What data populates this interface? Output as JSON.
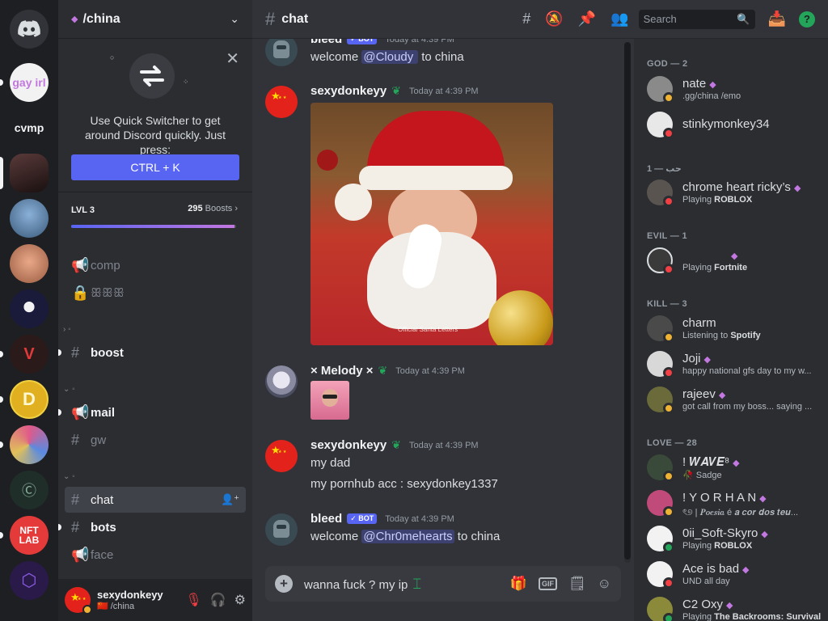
{
  "topbar": {
    "channel": "chat",
    "search_placeholder": "Search"
  },
  "guild": {
    "name": "/china"
  },
  "quick_switcher": {
    "text": "Use Quick Switcher to get around Discord quickly. Just press:",
    "shortcut": "CTRL + K"
  },
  "boost": {
    "level": "LVL 3",
    "count": "295",
    "count_suffix": " Boosts",
    "progress_fraction": 0.99
  },
  "rail": {
    "servers": [
      {
        "label": "gay irl",
        "bg": "#f2f2f2"
      },
      {
        "label": "cvmp",
        "bg": "#1e1f22"
      },
      {
        "label": "",
        "bg": "#3a2a2a"
      },
      {
        "label": "",
        "bg": "#4a6a8a"
      },
      {
        "label": "",
        "bg": "#c88060"
      },
      {
        "label": "",
        "bg": "#1a1a3a"
      },
      {
        "label": "",
        "bg": "#2b1a1a"
      },
      {
        "label": "",
        "bg": "#e0b020"
      },
      {
        "label": "",
        "bg": "#6a5a8a"
      },
      {
        "label": "",
        "bg": "#1f2e28"
      },
      {
        "label": "NFT LAB",
        "bg": "#e53a3a"
      },
      {
        "label": "",
        "bg": "#2a1a4a"
      }
    ]
  },
  "channels": {
    "comp": "comp",
    "locked": "ꕥꕥꕥ",
    "cat1": "› ◦",
    "boost": "boost",
    "cat2": "⌄ ◦",
    "mail": "mail",
    "gw": "gw",
    "cat3": "⌄ ◦",
    "chat": "chat",
    "bots": "bots",
    "face": "face"
  },
  "user": {
    "name": "sexydonkeyy",
    "sub": "🇨🇳 /china"
  },
  "messages": [
    {
      "author": "bleed",
      "tag": "✓ BOT",
      "time": "Today at 4:39 PM",
      "prefix": "welcome ",
      "mention": "@Cloudy ",
      "suffix": " to china"
    },
    {
      "author": "sexydonkeyy",
      "time": "Today at 4:39 PM",
      "image_watermark": "Official Santa Letters"
    },
    {
      "author": "× Melody ×",
      "time": "Today at 4:39 PM"
    },
    {
      "author": "sexydonkeyy",
      "time": "Today at 4:39 PM",
      "line1": "my dad",
      "line2": "my pornhub acc : sexydonkey1337"
    },
    {
      "author": "bleed",
      "tag": "✓ BOT",
      "time": "Today at 4:39 PM",
      "prefix": "welcome ",
      "mention": "@Chr0mehearts",
      "suffix": " to china"
    }
  ],
  "composer": {
    "value": "wanna fuck ? my ip",
    "gif": "GIF"
  },
  "members": {
    "roles": [
      {
        "title": "GOD — 2"
      },
      {
        "title": "حب — 1"
      },
      {
        "title": "EVIL — 1"
      },
      {
        "title": "KILL — 3"
      },
      {
        "title": "LOVE — 28"
      }
    ],
    "list": [
      {
        "name": "nate",
        "sub": ".gg/china /emo",
        "status": "idle",
        "color": "#8a8a8a"
      },
      {
        "name": "stinkymonkey34",
        "sub": "",
        "status": "dnd",
        "color": "#e8e8e8"
      },
      {
        "name": "chrome heart ricky’s",
        "sub_pre": "Playing ",
        "sub_bold": "ROBLOX",
        "status": "dnd",
        "color": "#5a5450"
      },
      {
        "name": "",
        "sub_pre": "Playing ",
        "sub_bold": "Fortnite",
        "status": "dnd",
        "color": "#3a3a3a"
      },
      {
        "name": "charm",
        "sub_pre": "Listening to ",
        "sub_bold": "Spotify",
        "status": "idle",
        "color": "#4a4a4a"
      },
      {
        "name": "Joji",
        "sub": "happy national gfs day to my w...",
        "status": "dnd",
        "color": "#d8d8d8"
      },
      {
        "name": "rajeev",
        "sub": "got call from my boss... saying ...",
        "status": "idle",
        "color": "#6a6a3a"
      },
      {
        "name": "! 𝑾𝑨𝑽𝑬⁸",
        "sub": "🥀 Sadge",
        "status": "idle",
        "color": "#3a4a3a"
      },
      {
        "name": "! Y O R H A N",
        "sub": "ৎ୭ | 𝑷𝒐𝒆𝒔𝒊𝒂 é 𝒂 𝒄𝒐𝒓 𝒅𝒐𝒔 𝒕𝒆𝒖...",
        "status": "idle",
        "color": "#c04a7a"
      },
      {
        "name": "0ii_Soft-Skyro",
        "sub_pre": "Playing ",
        "sub_bold": "ROBLOX",
        "status": "on",
        "color": "#f2f2f2"
      },
      {
        "name": "Ace is bad",
        "sub": "UND all day",
        "status": "dnd",
        "color": "#f2f2f2"
      },
      {
        "name": "C2 Oxy",
        "sub_pre": "Playing ",
        "sub_bold": "The Backrooms: Survival",
        "status": "on",
        "color": "#8a8a3a"
      }
    ]
  },
  "colors": {
    "accent": "#5865f2",
    "online": "#23a55a",
    "idle": "#f0b232",
    "dnd": "#f23f43",
    "nitro_gem": "#c377e0"
  }
}
